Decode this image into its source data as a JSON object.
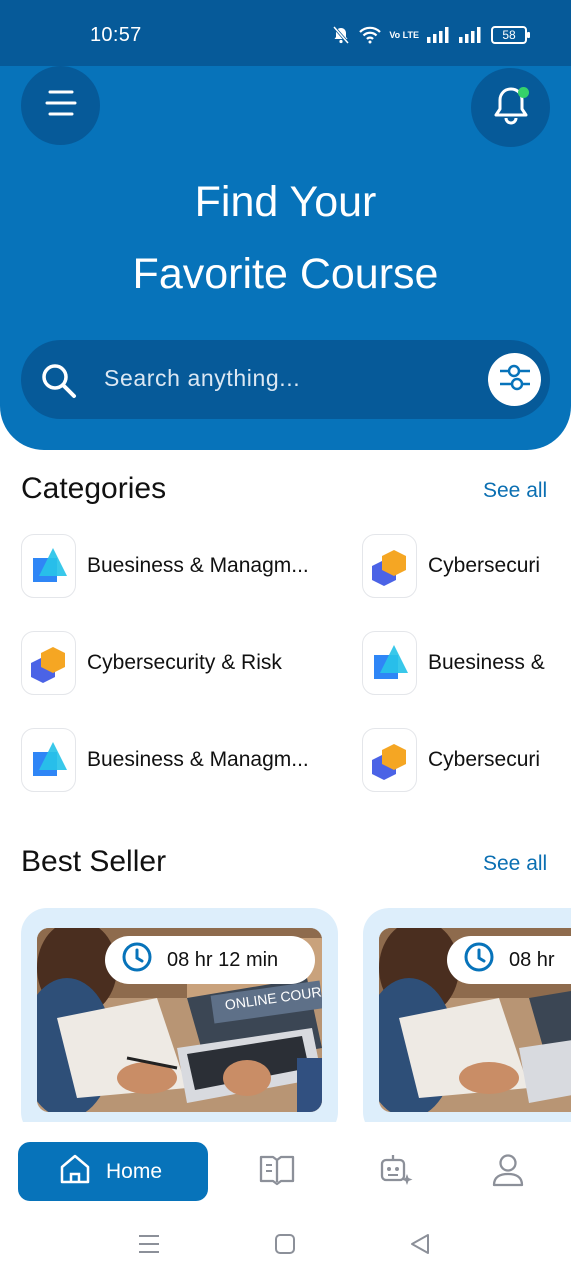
{
  "status_bar": {
    "time": "10:57",
    "battery": "58",
    "network_label": "Vo LTE"
  },
  "header": {
    "title_line1": "Find Your",
    "title_line2": "Favorite Course",
    "has_notification": true
  },
  "search": {
    "placeholder": "Search anything..."
  },
  "categories": {
    "title": "Categories",
    "see_all": "See all",
    "items": [
      {
        "label": "Buesiness & Managm...",
        "icon": "business-icon"
      },
      {
        "label": "Cybersecuri",
        "icon": "cybersecurity-icon"
      },
      {
        "label": "Cybersecurity & Risk",
        "icon": "cybersecurity-icon"
      },
      {
        "label": "Buesiness &",
        "icon": "business-icon"
      },
      {
        "label": "Buesiness & Managm...",
        "icon": "business-icon"
      },
      {
        "label": "Cybersecuri",
        "icon": "cybersecurity-icon"
      }
    ]
  },
  "best_seller": {
    "title": "Best Seller",
    "see_all": "See all",
    "courses": [
      {
        "duration": "08 hr 12 min",
        "image_text": "ONLINE COURSE"
      },
      {
        "duration": "08 hr",
        "image_text": ""
      }
    ]
  },
  "bottom_nav": {
    "home_label": "Home",
    "items": [
      "home-icon",
      "book-icon",
      "ai-bot-icon",
      "profile-icon"
    ]
  },
  "colors": {
    "primary": "#0773ba",
    "primary_dark": "#065a99",
    "card_bg": "#ddeefb",
    "accent_orange": "#f5a623",
    "accent_blue": "#2f86f6"
  }
}
